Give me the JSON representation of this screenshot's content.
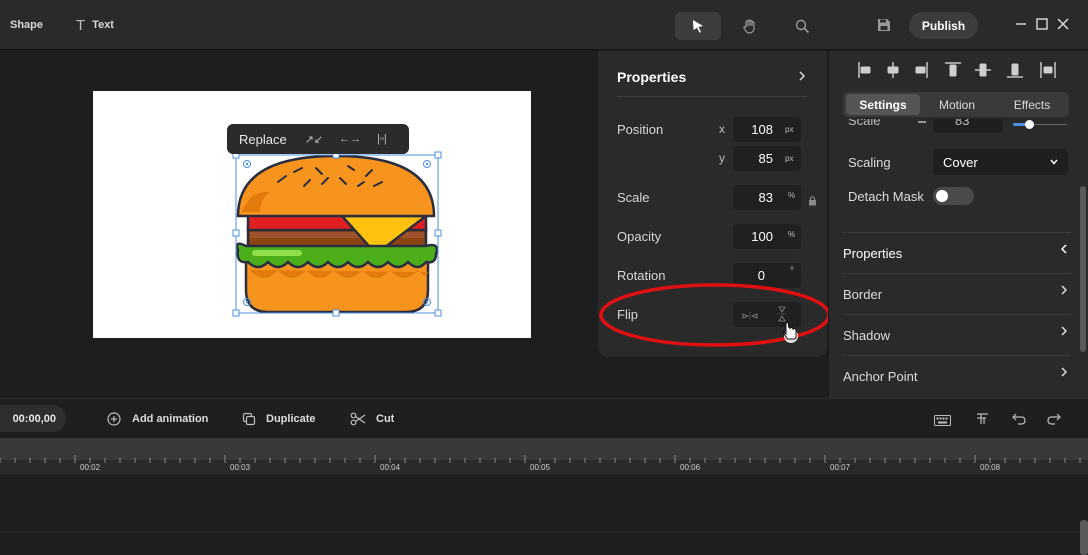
{
  "topbar": {
    "shape_label": "Shape",
    "text_label": "Text",
    "text_icon_glyph": "T",
    "publish_label": "Publish",
    "tools": [
      "pointer-icon",
      "hand-icon",
      "search-icon"
    ]
  },
  "canvas": {
    "floating_toolbar": {
      "replace_label": "Replace",
      "expand_icon": "↗↙",
      "swap_icon": "←→",
      "fit_icon": "|▫|"
    }
  },
  "properties": {
    "title": "Properties",
    "position_label": "Position",
    "x_label": "x",
    "y_label": "y",
    "x_value": "108",
    "y_value": "85",
    "px_unit": "px",
    "scale_label": "Scale",
    "scale_value": "83",
    "percent_unit": "%",
    "opacity_label": "Opacity",
    "opacity_value": "100",
    "rotation_label": "Rotation",
    "rotation_value": "0",
    "degree_unit": "°",
    "flip_label": "Flip"
  },
  "right_panel": {
    "tabs": [
      {
        "label": "Settings",
        "active": true
      },
      {
        "label": "Motion",
        "active": false
      },
      {
        "label": "Effects",
        "active": false
      }
    ],
    "partial_scale_label": "Scale",
    "partial_scale_value": "83",
    "scaling_label": "Scaling",
    "scaling_value": "Cover",
    "detach_mask_label": "Detach Mask",
    "detach_mask_on": false,
    "sections": [
      {
        "label": "Properties",
        "expanded": true
      },
      {
        "label": "Border",
        "expanded": false
      },
      {
        "label": "Shadow",
        "expanded": false
      },
      {
        "label": "Anchor Point",
        "expanded": false
      }
    ]
  },
  "bottombar": {
    "timecode": "00:00,00",
    "add_animation_label": "Add animation",
    "duplicate_label": "Duplicate",
    "cut_label": "Cut"
  },
  "timeline": {
    "ticks": [
      "00:02",
      "00:03",
      "00:04",
      "00:05",
      "00:06",
      "00:07",
      "00:08"
    ]
  },
  "colors": {
    "annotation_ellipse": "#e01010",
    "bun": "#f7941d",
    "cheese": "#ffc20e",
    "lettuce": "#4caf1a",
    "patty": "#8b4513",
    "tomato": "#e02020"
  }
}
